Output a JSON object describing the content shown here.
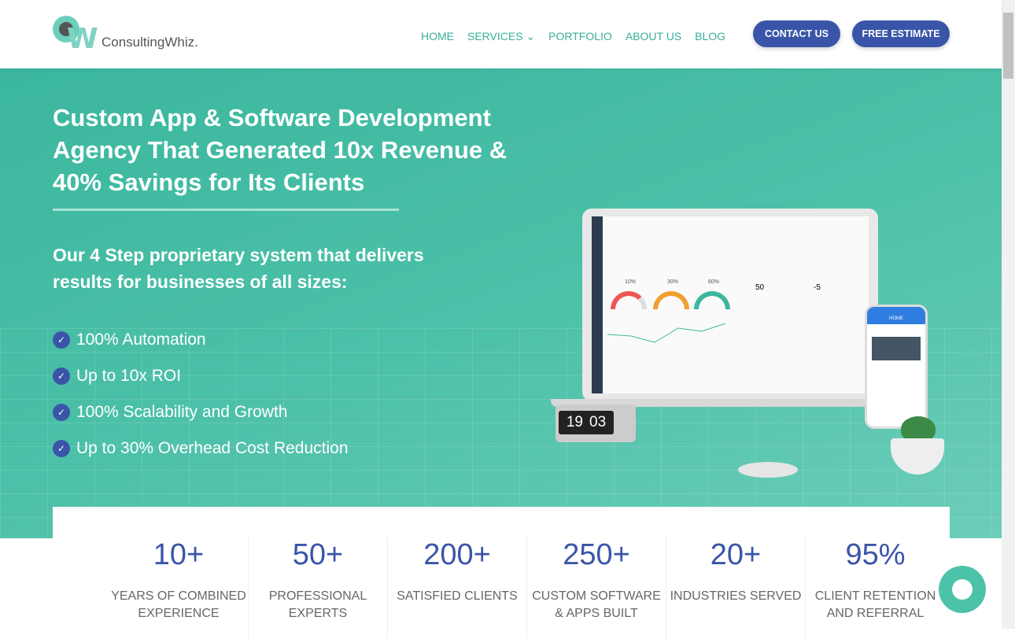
{
  "header": {
    "logo_text": "ConsultingWhiz.",
    "nav": [
      "HOME",
      "SERVICES",
      "PORTFOLIO",
      "ABOUT US",
      "BLOG"
    ],
    "contact": "CONTACT US",
    "estimate": "FREE ESTIMATE"
  },
  "hero": {
    "title": "Custom App & Software Development Agency That Generated 10x Revenue & 40% Savings for Its Clients",
    "subtitle": "Our 4 Step proprietary system that delivers results for businesses of all sizes:",
    "bullets": [
      "100% Automation",
      "Up to 10x ROI",
      "100% Scalability and Growth",
      "Up to 30% Overhead Cost Reduction"
    ],
    "mockup": {
      "gauges": [
        "10%",
        "30%",
        "60%"
      ],
      "nps": "50",
      "score": "-5",
      "clock_h": "19",
      "clock_m": "03",
      "phone_title": "HOME"
    }
  },
  "stats": [
    {
      "value": "10+",
      "label": "YEARS OF COMBINED EXPERIENCE"
    },
    {
      "value": "50+",
      "label": "PROFESSIONAL EXPERTS"
    },
    {
      "value": "200+",
      "label": "SATISFIED CLIENTS"
    },
    {
      "value": "250+",
      "label": "CUSTOM SOFTWARE & APPS BUILT"
    },
    {
      "value": "20+",
      "label": "INDUSTRIES SERVED"
    },
    {
      "value": "95%",
      "label": "CLIENT RETENTION AND REFERRAL"
    }
  ],
  "colors": {
    "accent": "#3a55a8",
    "teal": "#3bb79e"
  }
}
